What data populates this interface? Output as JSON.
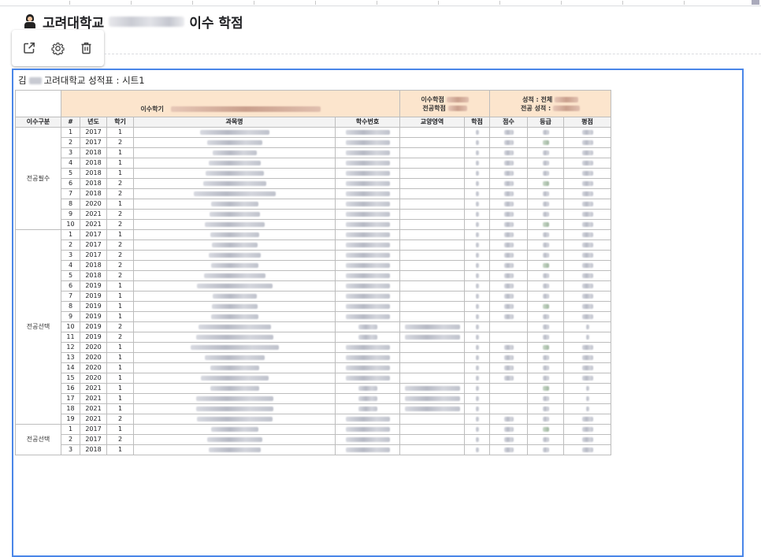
{
  "page": {
    "title_prefix": "고려대학교",
    "title_suffix": "이수 학점"
  },
  "toolbar": {
    "icons": [
      "open-external-icon",
      "gear-icon",
      "trash-icon"
    ]
  },
  "sheet": {
    "title_prefix": "김",
    "title_suffix": "고려대학교 성적표 : 시트1"
  },
  "table": {
    "header_top": {
      "semester_label": "이수학기",
      "credits_label_1": "이수학점",
      "credits_label_2": "전공학점",
      "grade_label_1": "성적 : 전체",
      "grade_label_2": "전공 성적 :"
    },
    "columns": [
      "이수구분",
      "#",
      "년도",
      "학기",
      "과목명",
      "학수번호",
      "교양영역",
      "학점",
      "점수",
      "등급",
      "평점"
    ],
    "groups": [
      {
        "category": "전공필수",
        "rows": [
          {
            "num": "1",
            "year": "2017",
            "sem": "1"
          },
          {
            "num": "2",
            "year": "2017",
            "sem": "2"
          },
          {
            "num": "3",
            "year": "2018",
            "sem": "1"
          },
          {
            "num": "4",
            "year": "2018",
            "sem": "1"
          },
          {
            "num": "5",
            "year": "2018",
            "sem": "1"
          },
          {
            "num": "6",
            "year": "2018",
            "sem": "2"
          },
          {
            "num": "7",
            "year": "2018",
            "sem": "2"
          },
          {
            "num": "8",
            "year": "2020",
            "sem": "1"
          },
          {
            "num": "9",
            "year": "2021",
            "sem": "2"
          },
          {
            "num": "10",
            "year": "2021",
            "sem": "2"
          }
        ]
      },
      {
        "category": "전공선택",
        "rows": [
          {
            "num": "1",
            "year": "2017",
            "sem": "1"
          },
          {
            "num": "2",
            "year": "2017",
            "sem": "2"
          },
          {
            "num": "3",
            "year": "2017",
            "sem": "2"
          },
          {
            "num": "4",
            "year": "2018",
            "sem": "2"
          },
          {
            "num": "5",
            "year": "2018",
            "sem": "2"
          },
          {
            "num": "6",
            "year": "2019",
            "sem": "1"
          },
          {
            "num": "7",
            "year": "2019",
            "sem": "1"
          },
          {
            "num": "8",
            "year": "2019",
            "sem": "1"
          },
          {
            "num": "9",
            "year": "2019",
            "sem": "1"
          },
          {
            "num": "10",
            "year": "2019",
            "sem": "2"
          },
          {
            "num": "11",
            "year": "2019",
            "sem": "2"
          },
          {
            "num": "12",
            "year": "2020",
            "sem": "1"
          },
          {
            "num": "13",
            "year": "2020",
            "sem": "1"
          },
          {
            "num": "14",
            "year": "2020",
            "sem": "1"
          },
          {
            "num": "15",
            "year": "2020",
            "sem": "1"
          },
          {
            "num": "16",
            "year": "2021",
            "sem": "1"
          },
          {
            "num": "17",
            "year": "2021",
            "sem": "1"
          },
          {
            "num": "18",
            "year": "2021",
            "sem": "1"
          },
          {
            "num": "19",
            "year": "2021",
            "sem": "2"
          }
        ]
      },
      {
        "category": "전공선택",
        "rows": [
          {
            "num": "1",
            "year": "2017",
            "sem": "1"
          },
          {
            "num": "2",
            "year": "2017",
            "sem": "2"
          },
          {
            "num": "3",
            "year": "2018",
            "sem": "1"
          }
        ]
      }
    ]
  }
}
